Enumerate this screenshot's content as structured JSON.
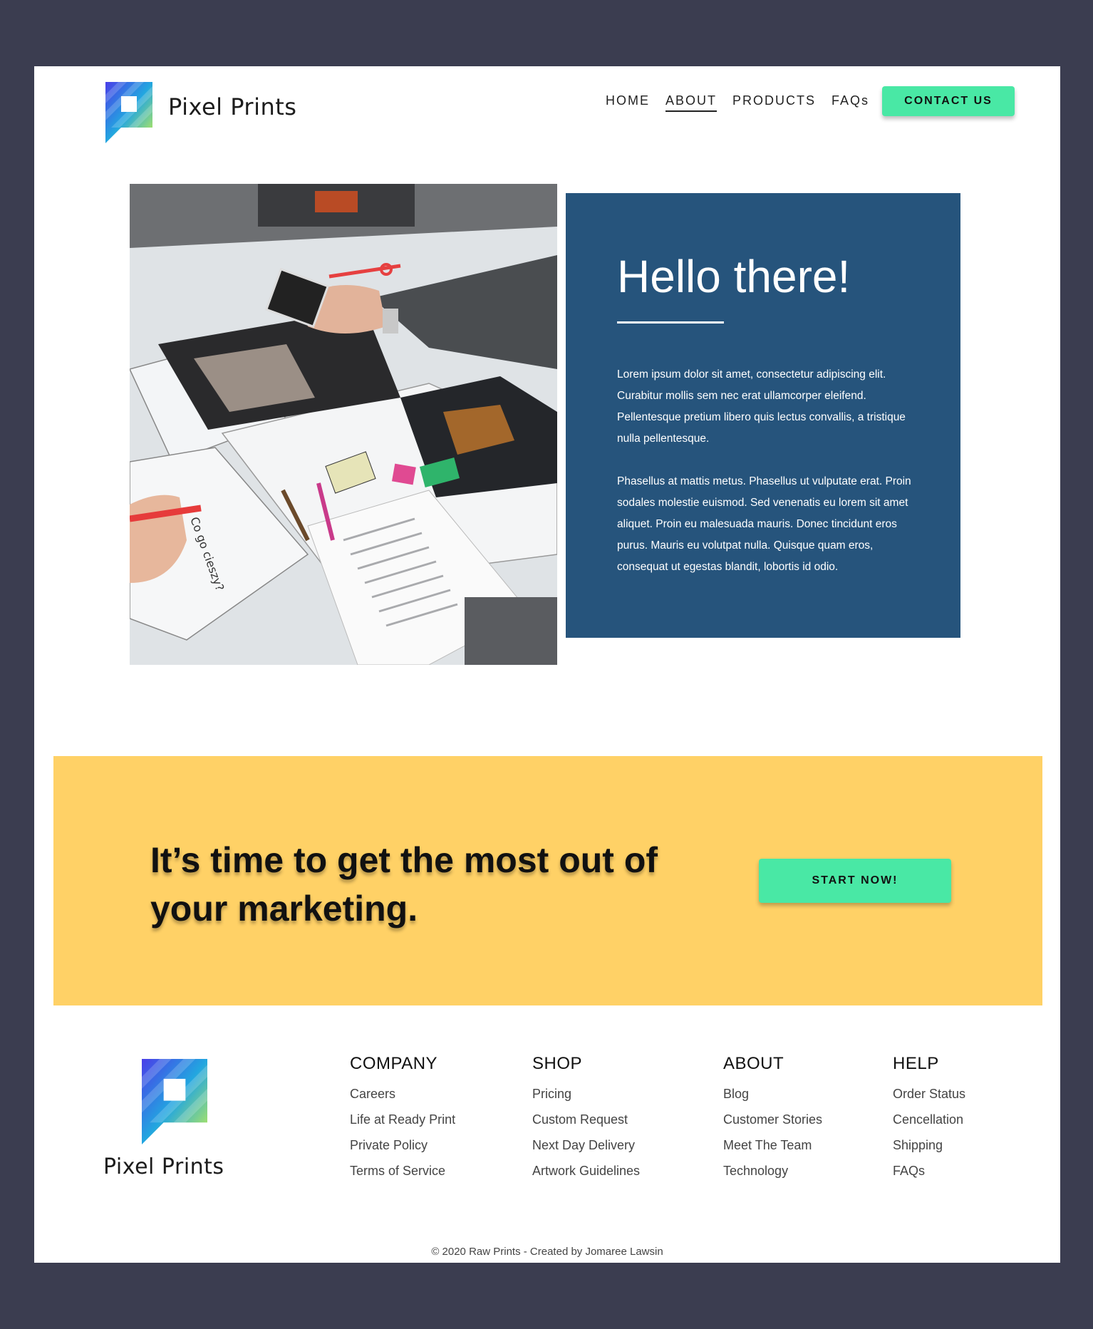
{
  "brand": {
    "name": "Pixel Prints"
  },
  "nav": {
    "items": [
      {
        "label": "HOME",
        "active": false
      },
      {
        "label": "ABOUT",
        "active": true
      },
      {
        "label": "PRODUCTS",
        "active": false
      },
      {
        "label": "FAQs",
        "active": false
      }
    ],
    "cta_label": "CONTACT US"
  },
  "hero": {
    "title": "Hello there!",
    "paragraphs": [
      "Lorem ipsum dolor sit amet, consectetur adipiscing elit. Curabitur mollis sem nec erat ullamcorper eleifend. Pellentesque pretium libero quis lectus convallis, a tristique nulla pellentesque.",
      "Phasellus at mattis metus. Phasellus ut vulputate erat. Proin sodales molestie euismod. Sed venenatis eu lorem sit amet aliquet. Proin eu malesuada mauris. Donec tincidunt eros purus. Mauris eu volutpat nulla. Quisque quam eros, consequat ut egestas blandit, lobortis id odio."
    ],
    "photo_icon": "print-workshop-photo"
  },
  "cta": {
    "heading": "It’s time to get the most out of your marketing.",
    "button_label": "START NOW!"
  },
  "footer": {
    "columns": [
      {
        "title": "COMPANY",
        "links": [
          "Careers",
          "Life at Ready Print",
          "Private Policy",
          "Terms of Service"
        ]
      },
      {
        "title": "SHOP",
        "links": [
          "Pricing",
          "Custom Request",
          "Next Day Delivery",
          "Artwork Guidelines"
        ]
      },
      {
        "title": "ABOUT",
        "links": [
          "Blog",
          "Customer Stories",
          "Meet The Team",
          "Technology"
        ]
      },
      {
        "title": "HELP",
        "links": [
          "Order Status",
          "Cencellation",
          "Shipping",
          "FAQs"
        ]
      }
    ],
    "copyright": "© 2020 Raw Prints - Created by Jomaree Lawsin"
  },
  "colors": {
    "background": "#3b3d50",
    "accent": "#49e8a5",
    "card": "#26547c",
    "cta_band": "#ffd166"
  }
}
